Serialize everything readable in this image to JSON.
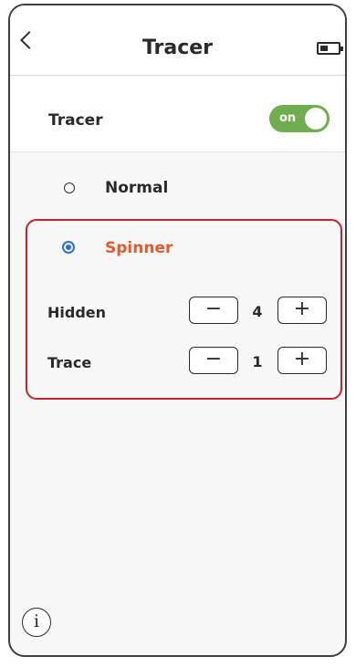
{
  "header": {
    "title": "Tracer"
  },
  "tracer_row": {
    "label": "Tracer",
    "toggle_text": "on",
    "enabled": true
  },
  "modes": {
    "normal": {
      "label": "Normal",
      "selected": false
    },
    "spinner": {
      "label": "Spinner",
      "selected": true
    }
  },
  "params": {
    "hidden": {
      "label": "Hidden",
      "minus": "−",
      "value": "4",
      "plus": "+"
    },
    "trace": {
      "label": "Trace",
      "minus": "−",
      "value": "1",
      "plus": "+"
    }
  },
  "info": {
    "glyph": "i"
  },
  "colors": {
    "accent_green": "#6fae4e",
    "spinner_orange": "#e45a2a",
    "highlight_red": "#c8202d",
    "radio_blue": "#2f6fd3"
  },
  "icons": [
    "back-chevron-icon",
    "battery-icon",
    "info-icon"
  ]
}
